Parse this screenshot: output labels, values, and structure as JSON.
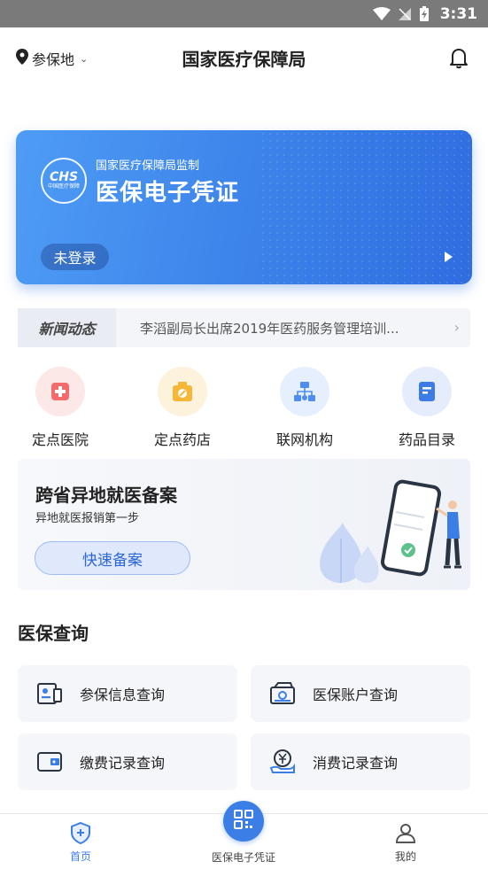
{
  "status_bar": {
    "time": "3:31"
  },
  "header": {
    "location_label": "参保地",
    "title": "国家医疗保障局"
  },
  "card": {
    "logo_text": "CHS",
    "logo_subtext": "中国医疗保障",
    "supervision": "国家医疗保障局监制",
    "title": "医保电子凭证",
    "login_status": "未登录"
  },
  "news": {
    "tag": "新闻动态",
    "headline": "李滔副局长出席2019年医药服务管理培训..."
  },
  "quick_links": [
    {
      "label": "定点医院",
      "icon": "hospital-icon",
      "color": "#f36b6b"
    },
    {
      "label": "定点药店",
      "icon": "pharmacy-icon",
      "color": "#f6b737"
    },
    {
      "label": "联网机构",
      "icon": "network-icon",
      "color": "#4f8ef0"
    },
    {
      "label": "药品目录",
      "icon": "catalog-icon",
      "color": "#3d7be6"
    }
  ],
  "banner": {
    "title": "跨省异地就医备案",
    "subtitle": "异地就医报销第一步",
    "button": "快速备案"
  },
  "query_section": {
    "title": "医保查询",
    "items": [
      {
        "label": "参保信息查询",
        "icon": "id-card-icon"
      },
      {
        "label": "医保账户查询",
        "icon": "account-icon"
      },
      {
        "label": "缴费记录查询",
        "icon": "wallet-icon"
      },
      {
        "label": "消费记录查询",
        "icon": "yuan-hand-icon"
      }
    ]
  },
  "tabbar": {
    "home": "首页",
    "voucher": "医保电子凭证",
    "me": "我的",
    "active_color": "#3b7fe6"
  }
}
